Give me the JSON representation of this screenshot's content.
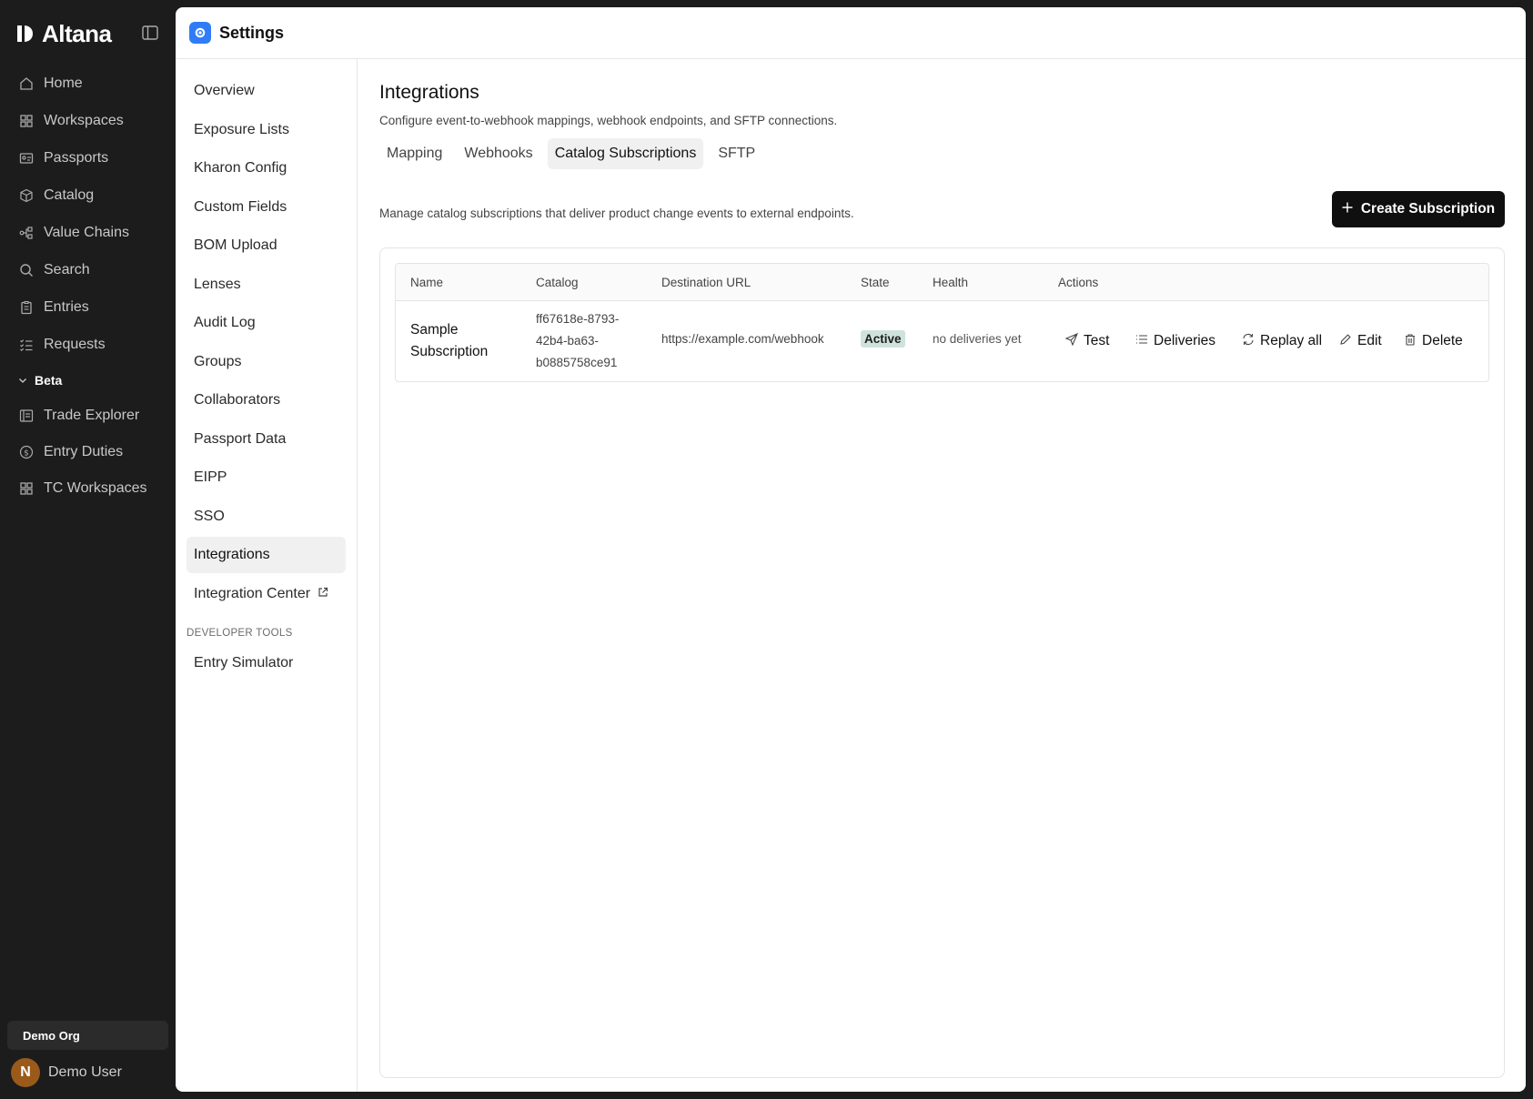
{
  "app": {
    "brand": "Altana",
    "nav": [
      {
        "label": "Home",
        "icon": "home-icon"
      },
      {
        "label": "Workspaces",
        "icon": "grid-icon"
      },
      {
        "label": "Passports",
        "icon": "id-card-icon"
      },
      {
        "label": "Catalog",
        "icon": "box-icon"
      },
      {
        "label": "Value Chains",
        "icon": "network-icon"
      },
      {
        "label": "Search",
        "icon": "search-icon"
      },
      {
        "label": "Entries",
        "icon": "clipboard-icon"
      },
      {
        "label": "Requests",
        "icon": "list-check-icon"
      }
    ],
    "beta_group": {
      "label": "Beta",
      "items": [
        {
          "label": "Trade Explorer",
          "icon": "explorer-icon"
        },
        {
          "label": "Entry Duties",
          "icon": "dollar-circle-icon"
        },
        {
          "label": "TC Workspaces",
          "icon": "grid-icon"
        }
      ]
    },
    "org": "Demo Org",
    "user": {
      "initial": "N",
      "name": "Demo User"
    }
  },
  "topbar": {
    "title": "Settings"
  },
  "settings_nav": {
    "items": [
      "Overview",
      "Exposure Lists",
      "Kharon Config",
      "Custom Fields",
      "BOM Upload",
      "Lenses",
      "Audit Log",
      "Groups",
      "Collaborators",
      "Passport Data",
      "EIPP",
      "SSO",
      "Integrations",
      "Integration Center"
    ],
    "active": "Integrations",
    "section_label": "DEVELOPER TOOLS",
    "dev_items": [
      "Entry Simulator"
    ]
  },
  "page": {
    "title": "Integrations",
    "subtitle": "Configure event-to-webhook mappings, webhook endpoints, and SFTP connections.",
    "tabs": [
      "Mapping",
      "Webhooks",
      "Catalog Subscriptions",
      "SFTP"
    ],
    "active_tab": "Catalog Subscriptions",
    "section_desc": "Manage catalog subscriptions that deliver product change events to external endpoints.",
    "create_label": "Create Subscription"
  },
  "table": {
    "columns": [
      "Name",
      "Catalog",
      "Destination URL",
      "State",
      "Health",
      "Actions"
    ],
    "rows": [
      {
        "name_line1": "Sample",
        "name_line2": "Subscription",
        "catalog_line1": "ff67618e-8793-",
        "catalog_line2": "42b4-ba63-",
        "catalog_line3": "b0885758ce91",
        "url": "https://example.com/webhook",
        "state": "Active",
        "health": "no deliveries yet",
        "actions": [
          "Test",
          "Deliveries",
          "Replay all",
          "Edit",
          "Delete"
        ]
      }
    ]
  },
  "colors": {
    "sidebar_bg": "#1c1c1c",
    "accent_blue": "#2f7cf6",
    "active_badge": "#cfe3dc",
    "primary_button": "#0f0f0f"
  }
}
